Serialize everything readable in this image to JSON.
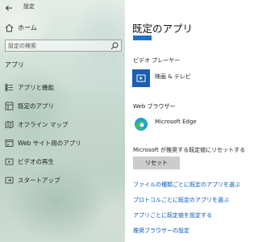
{
  "window": {
    "title": "設定"
  },
  "sidebar": {
    "home_label": "ホーム",
    "search_placeholder": "設定の検索",
    "section_label": "アプリ",
    "items": [
      {
        "label": "アプリと機能",
        "icon": "apps-list-icon"
      },
      {
        "label": "既定のアプリ",
        "icon": "default-apps-icon"
      },
      {
        "label": "オフライン マップ",
        "icon": "offline-map-icon"
      },
      {
        "label": "Web サイト用のアプリ",
        "icon": "website-apps-icon"
      },
      {
        "label": "ビデオの再生",
        "icon": "video-playback-icon"
      },
      {
        "label": "スタートアップ",
        "icon": "startup-icon"
      }
    ]
  },
  "main": {
    "title": "既定のアプリ",
    "video_player": {
      "category": "ビデオ プレーヤー",
      "app": "映画 & テレビ"
    },
    "web_browser": {
      "category": "Web ブラウザー",
      "app": "Microsoft Edge"
    },
    "reset": {
      "caption": "Microsoft が推奨する既定値にリセットする",
      "button_label": "リセット"
    },
    "links": [
      "ファイルの種類ごとに既定のアプリを選ぶ",
      "プロトコルごとに既定のアプリを選ぶ",
      "アプリごとに既定値を設定する",
      "推奨ブラウザーの設定"
    ]
  },
  "colors": {
    "accent": "#1e73c8",
    "link": "#0a58b8",
    "button_bg": "#cccccc"
  }
}
